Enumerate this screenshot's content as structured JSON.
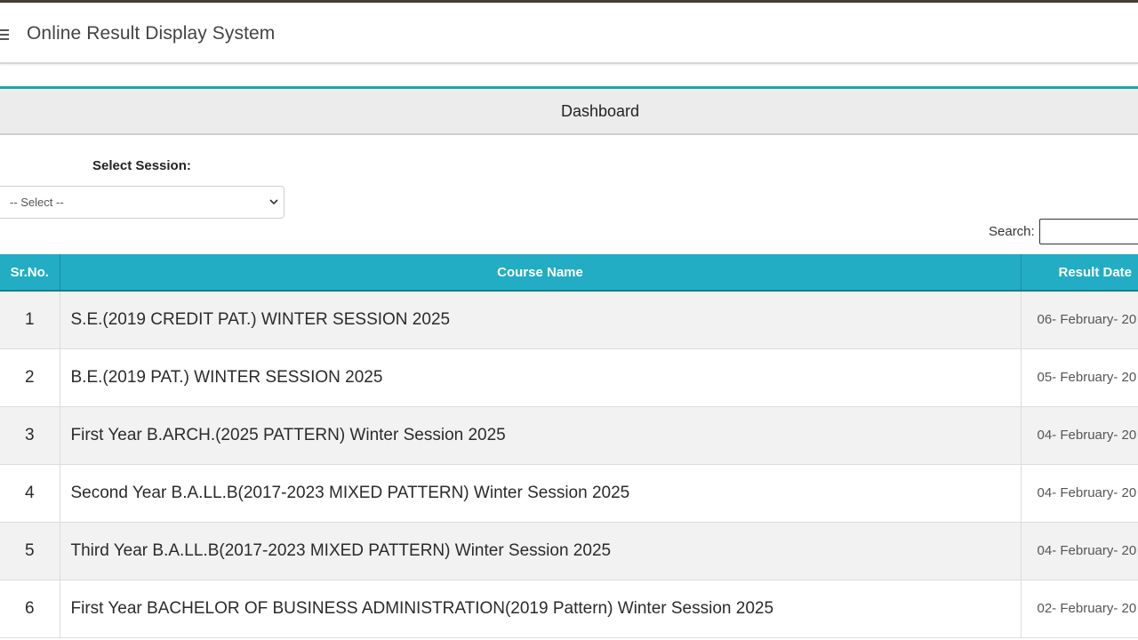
{
  "header": {
    "title": "Online Result Display System",
    "menu_icon": "hamburger-menu-icon"
  },
  "panel": {
    "title": "Dashboard"
  },
  "session": {
    "label": "Select Session:",
    "selected": "-- Select --"
  },
  "search": {
    "label": "Search:",
    "value": ""
  },
  "table": {
    "columns": [
      "Sr.No.",
      "Course Name",
      "Result Date"
    ],
    "rows": [
      {
        "sr": "1",
        "course": "S.E.(2019 CREDIT PAT.) WINTER SESSION 2025",
        "date": "06- February- 20"
      },
      {
        "sr": "2",
        "course": "B.E.(2019 PAT.) WINTER SESSION 2025",
        "date": "05- February- 20"
      },
      {
        "sr": "3",
        "course": "First Year B.ARCH.(2025 PATTERN) Winter Session 2025",
        "date": "04- February- 20"
      },
      {
        "sr": "4",
        "course": "Second Year B.A.LL.B(2017-2023 MIXED PATTERN) Winter Session 2025",
        "date": "04- February- 20"
      },
      {
        "sr": "5",
        "course": "Third Year B.A.LL.B(2017-2023 MIXED PATTERN) Winter Session 2025",
        "date": "04- February- 20"
      },
      {
        "sr": "6",
        "course": "First Year BACHELOR OF BUSINESS ADMINISTRATION(2019 Pattern) Winter Session 2025",
        "date": "02- February- 20"
      }
    ]
  },
  "colors": {
    "header_accent": "#22adc4",
    "panel_line": "#1fa3ad",
    "top_strip": "#4a3b32"
  }
}
